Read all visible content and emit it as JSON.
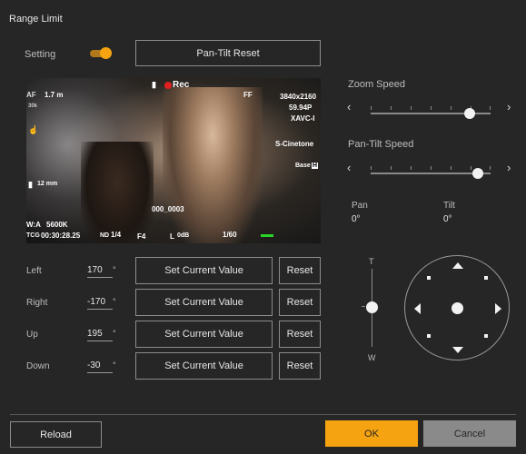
{
  "title": "Range Limit",
  "setting": {
    "label": "Setting",
    "toggle_on": true,
    "reset_button": "Pan-Tilt Reset"
  },
  "video": {
    "af": "AF",
    "focus_distance": "1.7 m",
    "zoom_small": "30k",
    "format_label": "FF",
    "resolution": "3840x2160",
    "frame_rate": "59.94P",
    "codec": "XAVC-I",
    "look": "S-Cinetone",
    "base": "Base",
    "base_badge": "H",
    "rec": "Rec",
    "clip_name": "000_0003",
    "distance2": "12 mm",
    "wb": "W:A",
    "kelvin": "5600K",
    "tc": "TCG",
    "timecode": "00:30:28.25",
    "nd": "ND",
    "nd_value": "1/4",
    "iris": "F4",
    "gain_label": "L",
    "gain_value": "0dB",
    "shutter": "1/60"
  },
  "zoom_speed": {
    "label": "Zoom Speed",
    "value": 0.86
  },
  "pan_tilt_speed": {
    "label": "Pan-Tilt Speed",
    "value": 0.93
  },
  "readouts": {
    "pan_label": "Pan",
    "pan_value": "0°",
    "tilt_label": "Tilt",
    "tilt_value": "0°"
  },
  "vertical_slider": {
    "top_label": "T",
    "bottom_label": "W"
  },
  "limits": {
    "rows": [
      {
        "label": "Left",
        "value": "170",
        "unit": "°",
        "set_label": "Set Current Value",
        "reset_label": "Reset"
      },
      {
        "label": "Right",
        "value": "-170",
        "unit": "°",
        "set_label": "Set Current Value",
        "reset_label": "Reset"
      },
      {
        "label": "Up",
        "value": "195",
        "unit": "°",
        "set_label": "Set Current Value",
        "reset_label": "Reset"
      },
      {
        "label": "Down",
        "value": "-30",
        "unit": "°",
        "set_label": "Set Current Value",
        "reset_label": "Reset"
      }
    ]
  },
  "footer": {
    "reload": "Reload",
    "ok": "OK",
    "cancel": "Cancel"
  },
  "colors": {
    "accent": "#f5a310",
    "background": "#262626",
    "rec": "#e02020",
    "cancel_bg": "#8a8a8a"
  }
}
